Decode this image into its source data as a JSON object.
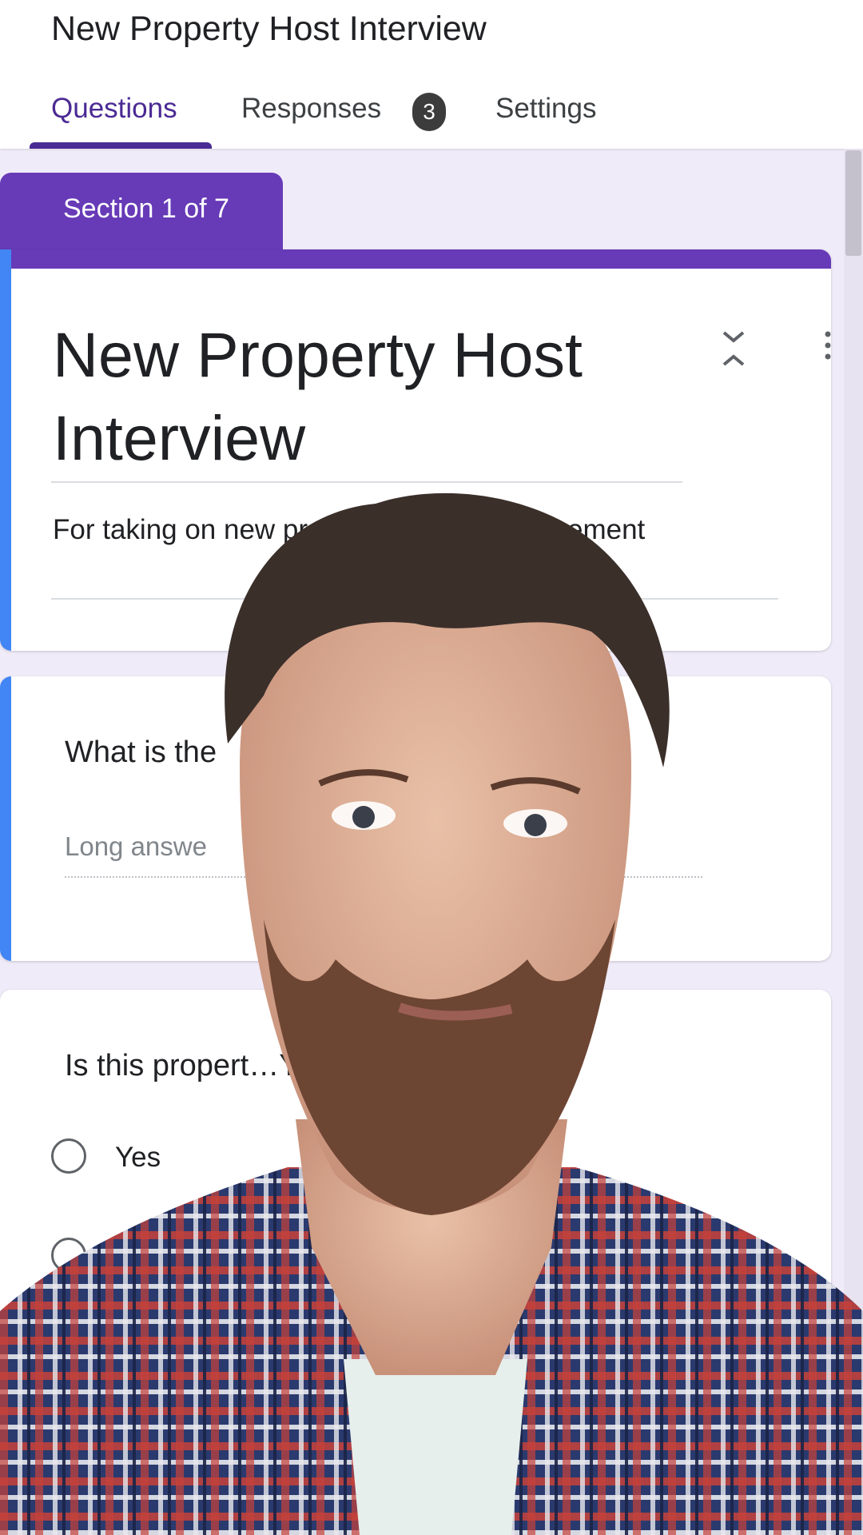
{
  "header": {
    "form_name": "New Property Host Interview",
    "tabs": [
      {
        "label": "Questions",
        "active": true
      },
      {
        "label": "Responses",
        "badge": "3"
      },
      {
        "label": "Settings"
      }
    ]
  },
  "section": {
    "label": "Section 1 of 7"
  },
  "title_card": {
    "title": "New Property Host Interview",
    "description": "For taking on new prope… host type agreement"
  },
  "questions": [
    {
      "title": "What is the",
      "placeholder": "Long answe"
    },
    {
      "title": "Is this propert…Y?",
      "options": [
        "Yes"
      ]
    }
  ],
  "colors": {
    "accent_purple": "#673ab7",
    "tab_active": "#4b2a94",
    "left_accent": "#4285f4",
    "background": "#f0ebf8"
  },
  "icons": {
    "collapse": "collapse-expand-icon",
    "more": "more-vert-icon",
    "radio": "radio-unchecked-icon"
  },
  "overlay": {
    "subject": "presenter webcam overlay"
  }
}
